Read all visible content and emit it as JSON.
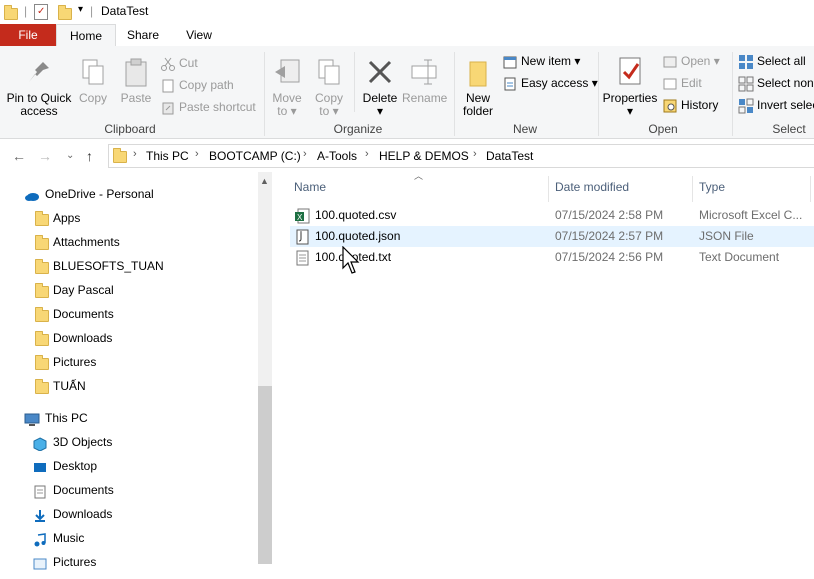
{
  "window": {
    "title": "DataTest"
  },
  "tabs": [
    "File",
    "Home",
    "Share",
    "View"
  ],
  "ribbon": {
    "clipboard": {
      "label": "Clipboard",
      "pin": [
        "Pin to Quick",
        "access"
      ],
      "copy": "Copy",
      "paste": "Paste",
      "cut": "Cut",
      "copy_path": "Copy path",
      "paste_shortcut": "Paste shortcut"
    },
    "organize": {
      "label": "Organize",
      "move_to": [
        "Move",
        "to"
      ],
      "copy_to": [
        "Copy",
        "to"
      ],
      "delete": "Delete",
      "rename": "Rename"
    },
    "new": {
      "label": "New",
      "new_folder": [
        "New",
        "folder"
      ],
      "new_item": "New item",
      "easy_access": "Easy access"
    },
    "open": {
      "label": "Open",
      "properties": "Properties",
      "open": "Open",
      "edit": "Edit",
      "history": "History"
    },
    "select": {
      "label": "Select",
      "select_all": "Select all",
      "select_none": "Select none",
      "invert_selection": "Invert selection"
    }
  },
  "address": {
    "crumbs": [
      "This PC",
      "BOOTCAMP (C:)",
      "A-Tools",
      "HELP & DEMOS",
      "DataTest"
    ]
  },
  "nav": {
    "onedrive": "OneDrive - Personal",
    "onedrive_items": [
      "Apps",
      "Attachments",
      "BLUESOFTS_TUAN",
      "Day Pascal",
      "Documents",
      "Downloads",
      "Pictures",
      "TUẤN"
    ],
    "this_pc": "This PC",
    "pc_items": [
      "3D Objects",
      "Desktop",
      "Documents",
      "Downloads",
      "Music",
      "Pictures"
    ]
  },
  "columns": {
    "name": "Name",
    "date": "Date modified",
    "type": "Type"
  },
  "files": [
    {
      "name": "100.quoted.csv",
      "date": "07/15/2024 2:58 PM",
      "type": "Microsoft Excel C...",
      "icon": "excel-csv-icon"
    },
    {
      "name": "100.quoted.json",
      "date": "07/15/2024 2:57 PM",
      "type": "JSON File",
      "icon": "json-file-icon"
    },
    {
      "name": "100.quoted.txt",
      "date": "07/15/2024 2:56 PM",
      "type": "Text Document",
      "icon": "text-file-icon"
    }
  ],
  "colors": {
    "file_tab": "#c42b1c",
    "hover_row": "#e5f3ff",
    "folder": "#f8d775",
    "accent": "#0063b1"
  }
}
